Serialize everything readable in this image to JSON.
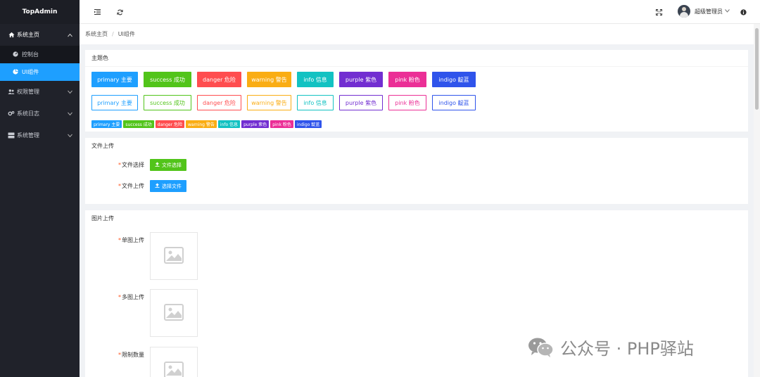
{
  "sidebar": {
    "brand": "TopAdmin",
    "menu": [
      {
        "label": "系统主页",
        "icon": "home-icon",
        "chevron": "⌃",
        "sub": [
          {
            "label": "控制台",
            "icon": "dashboard-icon",
            "active": false
          },
          {
            "label": "UI组件",
            "icon": "pie-icon",
            "active": true
          }
        ]
      },
      {
        "label": "权限管理",
        "icon": "users-icon",
        "chevron": "⌄"
      },
      {
        "label": "系统日志",
        "icon": "cogs-icon",
        "chevron": "⌄"
      },
      {
        "label": "系统管理",
        "icon": "server-icon",
        "chevron": "⌄"
      }
    ]
  },
  "header": {
    "user_name": "超级管理员"
  },
  "breadcrumb": {
    "home": "系统主页",
    "current": "UI组件"
  },
  "theme_card": {
    "title": "主题色",
    "buttons": [
      {
        "label": "primary 主要",
        "color": "#1e9fff"
      },
      {
        "label": "success 成功",
        "color": "#52c41a"
      },
      {
        "label": "danger 危险",
        "color": "#ff4d4f"
      },
      {
        "label": "warning 警告",
        "color": "#faad14"
      },
      {
        "label": "info 信息",
        "color": "#13c2c2"
      },
      {
        "label": "purple 紫色",
        "color": "#722ed1"
      },
      {
        "label": "pink 粉色",
        "color": "#eb2f96"
      },
      {
        "label": "indigo 靛蓝",
        "color": "#2f54eb"
      }
    ]
  },
  "file_card": {
    "title": "文件上传",
    "rows": [
      {
        "label": "文件选择",
        "button": "文件选择",
        "color": "#52c41a"
      },
      {
        "label": "文件上传",
        "button": "选择文件",
        "color": "#1e9fff"
      }
    ]
  },
  "image_card": {
    "title": "图片上传",
    "rows": [
      {
        "label": "单图上传"
      },
      {
        "label": "多图上传"
      },
      {
        "label": "限制数量"
      }
    ]
  },
  "watermark": {
    "text": "公众号 · PHP驿站"
  }
}
